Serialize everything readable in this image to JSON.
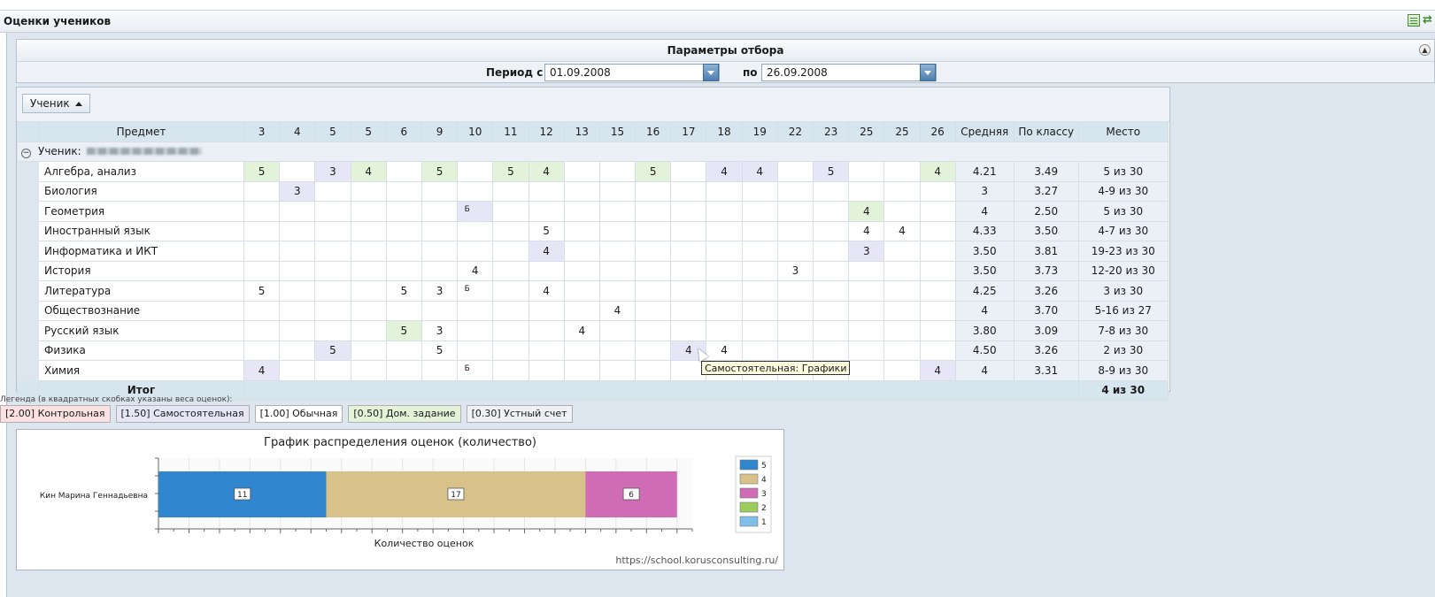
{
  "header": {
    "title": "Оценки учеников"
  },
  "params": {
    "title": "Параметры отбора",
    "period_label": "Период с",
    "date_from": "01.09.2008",
    "to_label": "по",
    "date_to": "26.09.2008"
  },
  "grid": {
    "group_button": "Ученик",
    "columns": {
      "subject": "Предмет",
      "avg": "Средняя",
      "class": "По классу",
      "place": "Место"
    },
    "day_columns": [
      "3",
      "4",
      "5",
      "5",
      "6",
      "9",
      "10",
      "11",
      "12",
      "13",
      "15",
      "16",
      "17",
      "18",
      "19",
      "22",
      "23",
      "25",
      "25",
      "26"
    ],
    "group_label": "Ученик:",
    "rows": [
      {
        "subject": "Алгебра, анализ",
        "avg": "4.21",
        "class": "3.49",
        "place": "5 из 30",
        "cells": [
          [
            "5",
            "g"
          ],
          [
            "",
            ""
          ],
          [
            "3",
            "b"
          ],
          [
            "4",
            "g"
          ],
          [
            "",
            ""
          ],
          [
            "5",
            "g"
          ],
          [
            "",
            ""
          ],
          [
            "5",
            "g"
          ],
          [
            "4",
            "g"
          ],
          [
            "",
            ""
          ],
          [
            "",
            ""
          ],
          [
            "5",
            "g"
          ],
          [
            "",
            ""
          ],
          [
            "4",
            "b"
          ],
          [
            "4",
            "b"
          ],
          [
            "",
            ""
          ],
          [
            "5",
            "b"
          ],
          [
            "",
            ""
          ],
          [
            "",
            ""
          ],
          [
            "4",
            "g"
          ]
        ]
      },
      {
        "subject": "Биология",
        "avg": "3",
        "class": "3.27",
        "place": "4-9 из 30",
        "cells": [
          [
            "",
            ""
          ],
          [
            "3",
            "b"
          ],
          [
            "",
            ""
          ],
          [
            "",
            ""
          ],
          [
            "",
            ""
          ],
          [
            "",
            ""
          ],
          [
            "",
            ""
          ],
          [
            "",
            ""
          ],
          [
            "",
            ""
          ],
          [
            "",
            ""
          ],
          [
            "",
            ""
          ],
          [
            "",
            ""
          ],
          [
            "",
            ""
          ],
          [
            "",
            ""
          ],
          [
            "",
            ""
          ],
          [
            "",
            ""
          ],
          [
            "",
            ""
          ],
          [
            "",
            ""
          ],
          [
            "",
            ""
          ],
          [
            "",
            ""
          ]
        ]
      },
      {
        "subject": "Геометрия",
        "avg": "4",
        "class": "2.50",
        "place": "5 из 30",
        "cells": [
          [
            "",
            ""
          ],
          [
            "",
            ""
          ],
          [
            "",
            ""
          ],
          [
            "",
            ""
          ],
          [
            "",
            ""
          ],
          [
            "",
            ""
          ],
          [
            "Б",
            "b"
          ],
          [
            "",
            ""
          ],
          [
            "",
            ""
          ],
          [
            "",
            ""
          ],
          [
            "",
            ""
          ],
          [
            "",
            ""
          ],
          [
            "",
            ""
          ],
          [
            "",
            ""
          ],
          [
            "",
            ""
          ],
          [
            "",
            ""
          ],
          [
            "",
            ""
          ],
          [
            "4",
            "g"
          ],
          [
            "",
            ""
          ],
          [
            "",
            ""
          ]
        ]
      },
      {
        "subject": "Иностранный язык",
        "avg": "4.33",
        "class": "3.50",
        "place": "4-7 из 30",
        "cells": [
          [
            "",
            ""
          ],
          [
            "",
            ""
          ],
          [
            "",
            ""
          ],
          [
            "",
            ""
          ],
          [
            "",
            ""
          ],
          [
            "",
            ""
          ],
          [
            "",
            ""
          ],
          [
            "",
            ""
          ],
          [
            "5",
            ""
          ],
          [
            "",
            ""
          ],
          [
            "",
            ""
          ],
          [
            "",
            ""
          ],
          [
            "",
            ""
          ],
          [
            "",
            ""
          ],
          [
            "",
            ""
          ],
          [
            "",
            ""
          ],
          [
            "",
            ""
          ],
          [
            "4",
            ""
          ],
          [
            "4",
            ""
          ],
          [
            "",
            ""
          ]
        ]
      },
      {
        "subject": "Информатика и ИКТ",
        "avg": "3.50",
        "class": "3.81",
        "place": "19-23 из 30",
        "cells": [
          [
            "",
            ""
          ],
          [
            "",
            ""
          ],
          [
            "",
            ""
          ],
          [
            "",
            ""
          ],
          [
            "",
            ""
          ],
          [
            "",
            ""
          ],
          [
            "",
            ""
          ],
          [
            "",
            ""
          ],
          [
            "4",
            "b"
          ],
          [
            "",
            ""
          ],
          [
            "",
            ""
          ],
          [
            "",
            ""
          ],
          [
            "",
            ""
          ],
          [
            "",
            ""
          ],
          [
            "",
            ""
          ],
          [
            "",
            ""
          ],
          [
            "",
            ""
          ],
          [
            "3",
            "b"
          ],
          [
            "",
            ""
          ],
          [
            "",
            ""
          ]
        ]
      },
      {
        "subject": "История",
        "avg": "3.50",
        "class": "3.73",
        "place": "12-20 из 30",
        "cells": [
          [
            "",
            ""
          ],
          [
            "",
            ""
          ],
          [
            "",
            ""
          ],
          [
            "",
            ""
          ],
          [
            "",
            ""
          ],
          [
            "",
            ""
          ],
          [
            "4",
            ""
          ],
          [
            "",
            ""
          ],
          [
            "",
            ""
          ],
          [
            "",
            ""
          ],
          [
            "",
            ""
          ],
          [
            "",
            ""
          ],
          [
            "",
            ""
          ],
          [
            "",
            ""
          ],
          [
            "",
            ""
          ],
          [
            "3",
            ""
          ],
          [
            "",
            ""
          ],
          [
            "",
            ""
          ],
          [
            "",
            ""
          ],
          [
            "",
            ""
          ]
        ]
      },
      {
        "subject": "Литература",
        "avg": "4.25",
        "class": "3.26",
        "place": "3 из 30",
        "cells": [
          [
            "5",
            ""
          ],
          [
            "",
            ""
          ],
          [
            "",
            ""
          ],
          [
            "",
            ""
          ],
          [
            "5",
            ""
          ],
          [
            "3",
            ""
          ],
          [
            "Б",
            ""
          ],
          [
            "",
            ""
          ],
          [
            "4",
            ""
          ],
          [
            "",
            ""
          ],
          [
            "",
            ""
          ],
          [
            "",
            ""
          ],
          [
            "",
            ""
          ],
          [
            "",
            ""
          ],
          [
            "",
            ""
          ],
          [
            "",
            ""
          ],
          [
            "",
            ""
          ],
          [
            "",
            ""
          ],
          [
            "",
            ""
          ],
          [
            "",
            ""
          ]
        ]
      },
      {
        "subject": "Обществознание",
        "avg": "4",
        "class": "3.70",
        "place": "5-16 из 27",
        "cells": [
          [
            "",
            ""
          ],
          [
            "",
            ""
          ],
          [
            "",
            ""
          ],
          [
            "",
            ""
          ],
          [
            "",
            ""
          ],
          [
            "",
            ""
          ],
          [
            "",
            ""
          ],
          [
            "",
            ""
          ],
          [
            "",
            ""
          ],
          [
            "",
            ""
          ],
          [
            "4",
            ""
          ],
          [
            "",
            ""
          ],
          [
            "",
            ""
          ],
          [
            "",
            ""
          ],
          [
            "",
            ""
          ],
          [
            "",
            ""
          ],
          [
            "",
            ""
          ],
          [
            "",
            ""
          ],
          [
            "",
            ""
          ],
          [
            "",
            ""
          ]
        ]
      },
      {
        "subject": "Русский язык",
        "avg": "3.80",
        "class": "3.09",
        "place": "7-8 из 30",
        "cells": [
          [
            "",
            ""
          ],
          [
            "",
            ""
          ],
          [
            "",
            ""
          ],
          [
            "",
            ""
          ],
          [
            "5",
            "g"
          ],
          [
            "3",
            ""
          ],
          [
            "",
            ""
          ],
          [
            "",
            ""
          ],
          [
            "",
            ""
          ],
          [
            "4",
            ""
          ],
          [
            "",
            ""
          ],
          [
            "",
            ""
          ],
          [
            "",
            ""
          ],
          [
            "",
            ""
          ],
          [
            "",
            ""
          ],
          [
            "",
            ""
          ],
          [
            "",
            ""
          ],
          [
            "",
            ""
          ],
          [
            "",
            ""
          ],
          [
            "",
            ""
          ]
        ]
      },
      {
        "subject": "Физика",
        "avg": "4.50",
        "class": "3.26",
        "place": "2 из 30",
        "cells": [
          [
            "",
            ""
          ],
          [
            "",
            ""
          ],
          [
            "5",
            "b"
          ],
          [
            "",
            ""
          ],
          [
            "",
            ""
          ],
          [
            "5",
            ""
          ],
          [
            "",
            ""
          ],
          [
            "",
            ""
          ],
          [
            "",
            ""
          ],
          [
            "",
            ""
          ],
          [
            "",
            ""
          ],
          [
            "",
            ""
          ],
          [
            "4",
            "b"
          ],
          [
            "4",
            ""
          ],
          [
            "",
            ""
          ],
          [
            "",
            ""
          ],
          [
            "",
            ""
          ],
          [
            "",
            ""
          ],
          [
            "",
            ""
          ],
          [
            "",
            ""
          ]
        ]
      },
      {
        "subject": "Химия",
        "avg": "4",
        "class": "3.31",
        "place": "8-9 из 30",
        "cells": [
          [
            "4",
            "b"
          ],
          [
            "",
            ""
          ],
          [
            "",
            ""
          ],
          [
            "",
            ""
          ],
          [
            "",
            ""
          ],
          [
            "",
            ""
          ],
          [
            "Б",
            ""
          ],
          [
            "",
            ""
          ],
          [
            "",
            ""
          ],
          [
            "",
            ""
          ],
          [
            "",
            ""
          ],
          [
            "",
            ""
          ],
          [
            "",
            ""
          ],
          [
            "",
            ""
          ],
          [
            "",
            ""
          ],
          [
            "",
            ""
          ],
          [
            "",
            ""
          ],
          [
            "",
            ""
          ],
          [
            "",
            ""
          ],
          [
            "4",
            "b"
          ]
        ]
      }
    ],
    "total_label": "Итог",
    "total_place": "4 из 30"
  },
  "tooltip": "Самостоятельная: Графики",
  "legend": {
    "caption": "Легенда (в квадратных скобках указаны веса оценок):",
    "items": [
      {
        "label": "[2.00] Контрольная",
        "bg": "#fbe1e1"
      },
      {
        "label": "[1.50] Самостоятельная",
        "bg": "#e6e6f7"
      },
      {
        "label": "[1.00] Обычная",
        "bg": "#ffffff"
      },
      {
        "label": "[0.50] Дом. задание",
        "bg": "#e2f3da"
      },
      {
        "label": "[0.30] Устный счет",
        "bg": "#eef1f5"
      }
    ]
  },
  "chart_data": {
    "type": "bar",
    "orientation": "horizontal-stacked",
    "title": "График распределения оценок (количество)",
    "xlabel": "Количество оценок",
    "ylabel": "",
    "categories": [
      "Кин Марина Геннадьевна"
    ],
    "xlim": [
      0,
      35
    ],
    "series": [
      {
        "name": "5",
        "values": [
          11
        ],
        "color": "#2f86cf"
      },
      {
        "name": "4",
        "values": [
          17
        ],
        "color": "#d9c28a"
      },
      {
        "name": "3",
        "values": [
          6
        ],
        "color": "#d06cb6"
      },
      {
        "name": "2",
        "values": [
          0
        ],
        "color": "#9acd5a"
      },
      {
        "name": "1",
        "values": [
          0
        ],
        "color": "#7fbfe8"
      }
    ],
    "legend_position": "right",
    "grid": true
  },
  "watermark": "https://school.korusconsulting.ru/"
}
